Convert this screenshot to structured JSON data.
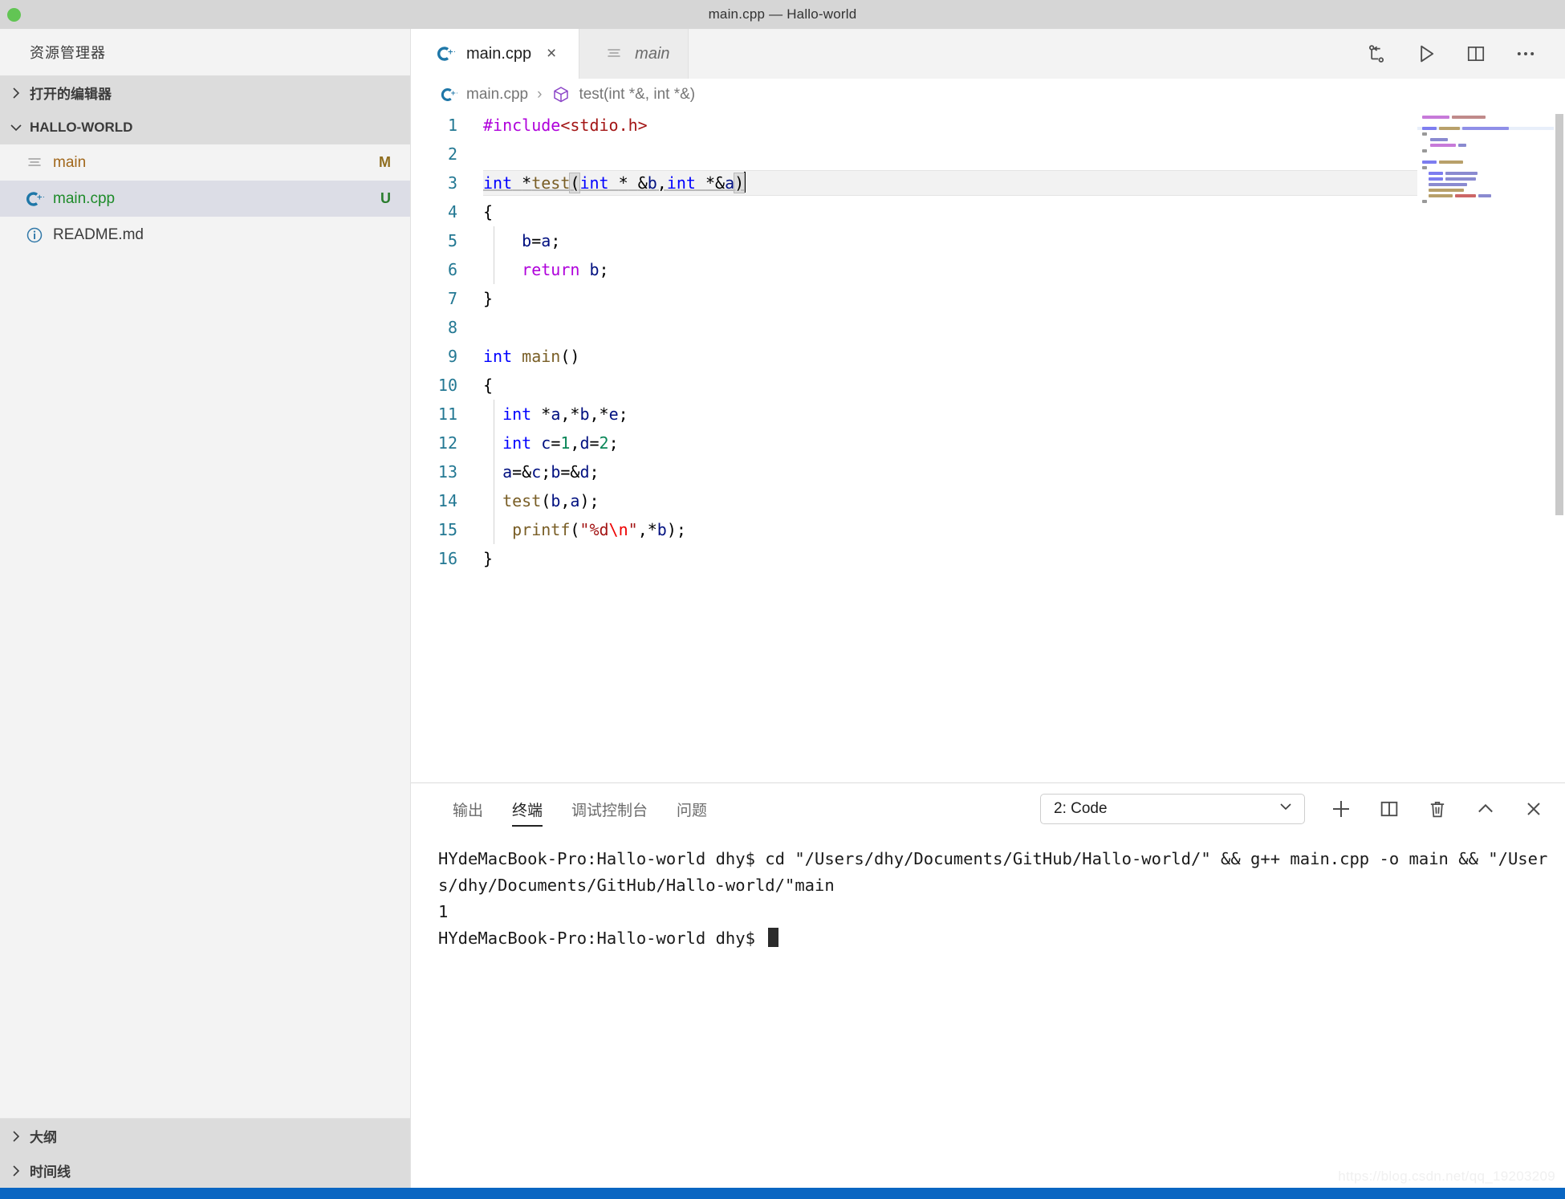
{
  "window": {
    "title": "main.cpp — Hallo-world",
    "traffic_lights": [
      "green"
    ]
  },
  "sidebar": {
    "title": "资源管理器",
    "sections": [
      {
        "label": "打开的编辑器",
        "expanded": false,
        "icon": "chevron-right-icon"
      },
      {
        "label": "HALLO-WORLD",
        "expanded": true,
        "icon": "chevron-down-icon"
      }
    ],
    "files": [
      {
        "name": "main",
        "icon": "binary-file-icon",
        "badge": "M",
        "badge_color": "#8f6d1f",
        "name_color": "#a1671b",
        "selected": false
      },
      {
        "name": "main.cpp",
        "icon": "cpp-file-icon",
        "badge": "U",
        "badge_color": "#2a7d2e",
        "name_color": "#1e8b2a",
        "selected": true
      },
      {
        "name": "README.md",
        "icon": "info-file-icon",
        "badge": "",
        "badge_color": "",
        "name_color": "#3b3b3b",
        "selected": false
      }
    ],
    "footer_sections": [
      {
        "label": "大纲",
        "icon": "chevron-right-icon"
      },
      {
        "label": "时间线",
        "icon": "chevron-right-icon"
      }
    ]
  },
  "editor": {
    "tabs": [
      {
        "label": "main.cpp",
        "icon": "cpp-file-icon",
        "active": true,
        "preview": false,
        "close": "×"
      },
      {
        "label": "main",
        "icon": "binary-file-icon",
        "active": false,
        "preview": true,
        "close": ""
      }
    ],
    "actions": [
      {
        "name": "run-debug-icon"
      },
      {
        "name": "run-play-icon"
      },
      {
        "name": "split-editor-icon"
      },
      {
        "name": "more-actions-icon"
      }
    ],
    "breadcrumb": [
      {
        "label": "main.cpp",
        "icon": "cpp-file-icon"
      },
      {
        "label": "test(int *&, int *&)",
        "icon": "symbol-method-icon"
      }
    ],
    "breadcrumb_separator": "›",
    "language": "cpp",
    "current_line": 3,
    "code_lines": [
      {
        "n": 1,
        "text": "#include<stdio.h>"
      },
      {
        "n": 2,
        "text": ""
      },
      {
        "n": 3,
        "text": "int *test(int * &b,int *&a)"
      },
      {
        "n": 4,
        "text": "{"
      },
      {
        "n": 5,
        "text": "    b=a;"
      },
      {
        "n": 6,
        "text": "    return b;"
      },
      {
        "n": 7,
        "text": "}"
      },
      {
        "n": 8,
        "text": ""
      },
      {
        "n": 9,
        "text": "int main()"
      },
      {
        "n": 10,
        "text": "{"
      },
      {
        "n": 11,
        "text": "  int *a,*b,*e;"
      },
      {
        "n": 12,
        "text": "  int c=1,d=2;"
      },
      {
        "n": 13,
        "text": "  a=&c;b=&d;"
      },
      {
        "n": 14,
        "text": "  test(b,a);"
      },
      {
        "n": 15,
        "text": "   printf(\"%d\\n\",*b);"
      },
      {
        "n": 16,
        "text": "}"
      }
    ]
  },
  "panel": {
    "tabs": [
      {
        "label": "输出",
        "active": false
      },
      {
        "label": "终端",
        "active": true
      },
      {
        "label": "调试控制台",
        "active": false
      },
      {
        "label": "问题",
        "active": false
      }
    ],
    "terminal_select": {
      "value": "2: Code",
      "chevron": "chevron-down-icon"
    },
    "actions": [
      {
        "name": "new-terminal-icon"
      },
      {
        "name": "split-terminal-icon"
      },
      {
        "name": "kill-terminal-icon"
      },
      {
        "name": "maximize-panel-icon"
      },
      {
        "name": "close-panel-icon"
      }
    ],
    "terminal_lines": [
      "HYdeMacBook-Pro:Hallo-world dhy$ cd \"/Users/dhy/Documents/GitHub/Hallo-world/\" && g++ main.cpp -o main && \"/Users/dhy/Documents/GitHub/Hallo-world/\"main",
      "1",
      "HYdeMacBook-Pro:Hallo-world dhy$ "
    ]
  },
  "statusbar": {
    "color": "#0a66c2"
  },
  "watermark": {
    "text": "https://blog.csdn.net/qq_19203209"
  },
  "colors": {
    "accent": "#0a66c2",
    "sidebar_bg": "#f3f3f3",
    "selected_row": "#dcdde6",
    "section_bg": "#dcdcdc",
    "line_number": "#237893",
    "keyword": "#0000ff",
    "function": "#795e26",
    "preprocessor": "#af00db",
    "string": "#a31515",
    "number": "#098658",
    "identifier": "#001080",
    "escape": "#ee0000"
  }
}
